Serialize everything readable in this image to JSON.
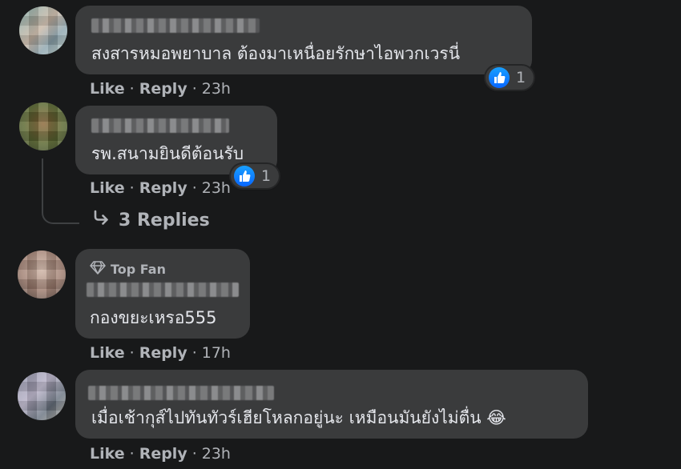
{
  "comments": [
    {
      "text": "สงสารหมอพยาบาล ต้องมาเหนื่อยรักษาไอพวกเวรนี่",
      "like_label": "Like",
      "reply_label": "Reply",
      "time": "23h",
      "reaction_count": "1"
    },
    {
      "text": "รพ.สนามยินดีต้อนรับ",
      "like_label": "Like",
      "reply_label": "Reply",
      "time": "23h",
      "reaction_count": "1",
      "replies_label": "3 Replies"
    },
    {
      "badge": "Top Fan",
      "text": "กองขยะเหรอ555",
      "like_label": "Like",
      "reply_label": "Reply",
      "time": "17h"
    },
    {
      "text": "เมื่อเช้ากุส์ไปทันทัวร์เฮียโหลกอยู่นะ เหมือนมันยังไม่ตื่น 😂",
      "like_label": "Like",
      "reply_label": "Reply",
      "time": "23h"
    }
  ],
  "colors": {
    "background": "#18191a",
    "bubble": "#3a3b3c",
    "text": "#e4e6eb",
    "secondary": "#b0b3b8",
    "like_blue": "#0866ff"
  }
}
